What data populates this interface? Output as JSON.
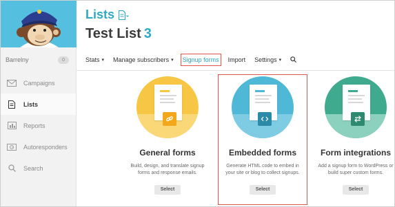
{
  "sidebar": {
    "logo_icon": "freddie-chimp-logo",
    "username": "Barrelny",
    "badge_count": "0",
    "items": [
      {
        "label": "Campaigns",
        "icon": "envelope-icon",
        "active": false
      },
      {
        "label": "Lists",
        "icon": "document-icon",
        "active": true
      },
      {
        "label": "Reports",
        "icon": "bar-chart-icon",
        "active": false
      },
      {
        "label": "Autoresponders",
        "icon": "autoresponder-icon",
        "active": false
      },
      {
        "label": "Search",
        "icon": "search-icon",
        "active": false
      }
    ]
  },
  "header": {
    "section_title": "Lists",
    "list_name": "Test List",
    "list_number": "3"
  },
  "tabs": [
    {
      "label": "Stats",
      "dropdown": true
    },
    {
      "label": "Manage subscribers",
      "dropdown": true
    },
    {
      "label": "Signup forms",
      "dropdown": false,
      "highlighted": true
    },
    {
      "label": "Import",
      "dropdown": false
    },
    {
      "label": "Settings",
      "dropdown": true
    }
  ],
  "cards": [
    {
      "title": "General forms",
      "description": "Build, design, and translate signup forms and response emails.",
      "button": "Select",
      "icon": "link-icon",
      "color": "#f6c644"
    },
    {
      "title": "Embedded forms",
      "description": "Generate HTML code to embed in your site or blog to collect signups.",
      "button": "Select",
      "icon": "code-brackets-icon",
      "color": "#4fb8d6"
    },
    {
      "title": "Form integrations",
      "description": "Add a signup form to WordPress or build super custom forms.",
      "button": "Select",
      "icon": "swap-arrows-icon",
      "color": "#3faa8e"
    }
  ],
  "colors": {
    "accent_teal": "#2faac2",
    "highlight_red": "#e0544c",
    "sidebar_bg": "#f2f2f2",
    "logo_bg": "#55bfe0"
  }
}
